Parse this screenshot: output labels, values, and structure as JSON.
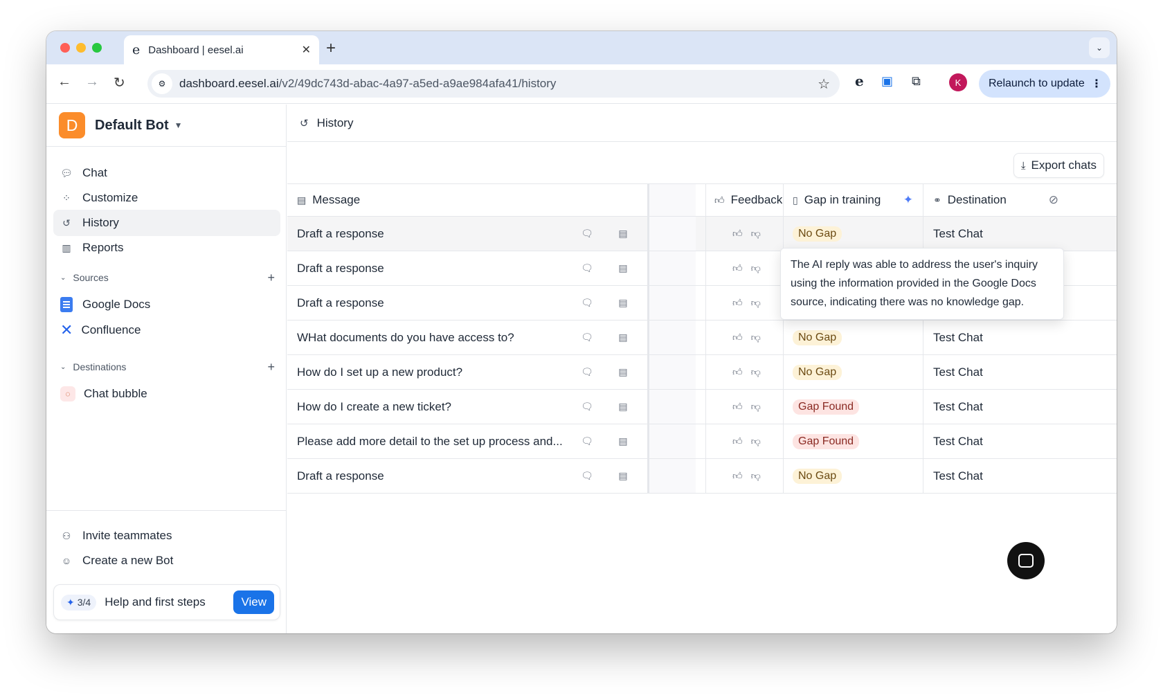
{
  "browser": {
    "tab_title": "Dashboard | eesel.ai",
    "tab_favicon": "e",
    "new_tab_label": "+",
    "url_host": "dashboard.eesel.ai",
    "url_path": "/v2/49dc743d-abac-4a97-a5ed-a9ae984afa41/history",
    "profile_initial": "K",
    "relaunch_label": "Relaunch to update",
    "ext_eesel": "e"
  },
  "sidebar": {
    "bot_initial": "D",
    "bot_name": "Default Bot",
    "nav": [
      {
        "label": "Chat",
        "icon": "chat-icon"
      },
      {
        "label": "Customize",
        "icon": "customize-icon"
      },
      {
        "label": "History",
        "icon": "history-icon",
        "active": true
      },
      {
        "label": "Reports",
        "icon": "reports-icon"
      }
    ],
    "sources_label": "Sources",
    "sources": [
      {
        "label": "Google Docs",
        "icon": "google-docs-icon"
      },
      {
        "label": "Confluence",
        "icon": "confluence-icon"
      }
    ],
    "destinations_label": "Destinations",
    "destinations": [
      {
        "label": "Chat bubble",
        "icon": "chat-bubble-icon"
      }
    ],
    "footer": [
      {
        "label": "Invite teammates",
        "icon": "invite-icon"
      },
      {
        "label": "Create a new Bot",
        "icon": "bot-icon"
      }
    ],
    "help": {
      "progress": "3/4",
      "label": "Help and first steps",
      "button": "View"
    }
  },
  "main": {
    "title": "History",
    "export_label": "Export chats",
    "columns": {
      "message": "Message",
      "feedback": "Feedback",
      "gap": "Gap in training",
      "destination": "Destination"
    },
    "rows": [
      {
        "message": "Draft a response",
        "gap": "No Gap",
        "destination": "Test Chat"
      },
      {
        "message": "Draft a response",
        "gap": "",
        "destination": ""
      },
      {
        "message": "Draft a response",
        "gap": "",
        "destination": ""
      },
      {
        "message": "WHat documents do you have access to?",
        "gap": "No Gap",
        "destination": "Test Chat"
      },
      {
        "message": "How do I set up a new product?",
        "gap": "No Gap",
        "destination": "Test Chat"
      },
      {
        "message": "How do I create a new ticket?",
        "gap": "Gap Found",
        "destination": "Test Chat"
      },
      {
        "message": "Please add more detail to the set up process and...",
        "gap": "Gap Found",
        "destination": "Test Chat"
      },
      {
        "message": "Draft a response",
        "gap": "No Gap",
        "destination": "Test Chat"
      }
    ],
    "tooltip": "The AI reply was able to address the user's inquiry using the information provided in the Google Docs source, indicating there was no knowledge gap."
  },
  "colors": {
    "accent": "#1a73e8",
    "bot_logo": "#fb8c2a",
    "no_gap_bg": "#fdf2d7",
    "gap_found_bg": "#fde4e2"
  }
}
